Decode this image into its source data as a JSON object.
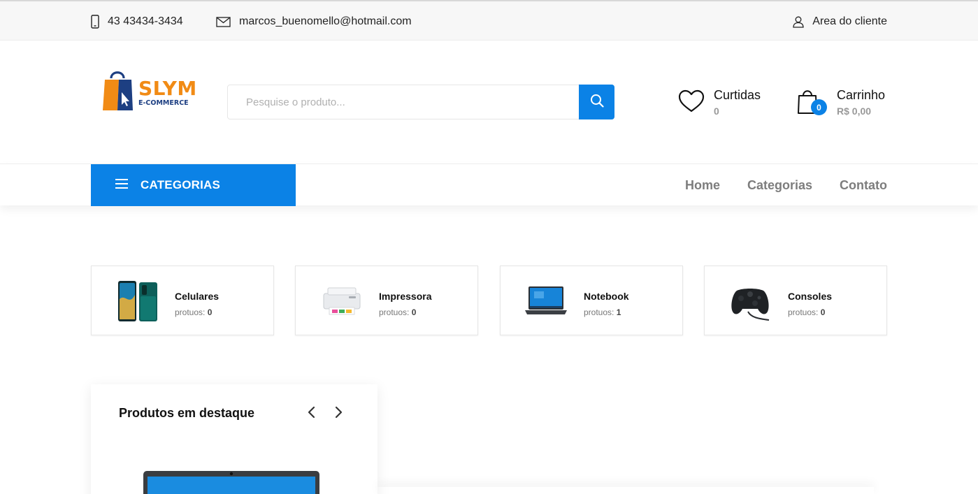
{
  "topbar": {
    "phone": "43 43434-3434",
    "email": "marcos_buenomello@hotmail.com",
    "client_area": "Area do cliente",
    "icons": [
      "phone-icon",
      "mail-icon",
      "user-icon"
    ]
  },
  "logo": {
    "brand": "SLYM",
    "tagline": "E-COMMERCE"
  },
  "search": {
    "placeholder": "Pesquise o produto...",
    "value": "",
    "icon": "search-icon"
  },
  "likes": {
    "label": "Curtidas",
    "count": "0",
    "icon": "heart-icon"
  },
  "cart": {
    "label": "Carrinho",
    "total": "R$ 0,00",
    "badge": "0",
    "icon": "shopping-bag-icon"
  },
  "nav": {
    "categories_button": "CATEGORIAS",
    "links": [
      "Home",
      "Categorias",
      "Contato"
    ]
  },
  "categories": [
    {
      "name": "Celulares",
      "count_label": "protuos:",
      "count": "0",
      "image": "phone-image"
    },
    {
      "name": "Impressora",
      "count_label": "protuos:",
      "count": "0",
      "image": "printer-image"
    },
    {
      "name": "Notebook",
      "count_label": "protuos:",
      "count": "1",
      "image": "laptop-image"
    },
    {
      "name": "Consoles",
      "count_label": "protuos:",
      "count": "0",
      "image": "controller-image"
    }
  ],
  "featured": {
    "title": "Produtos em destaque",
    "prev_icon": "chevron-left-icon",
    "next_icon": "chevron-right-icon"
  },
  "colors": {
    "primary": "#0b82e6",
    "brand_orange": "#f18b15",
    "brand_navy": "#1d3f82",
    "muted_text": "#7d7d7d"
  }
}
